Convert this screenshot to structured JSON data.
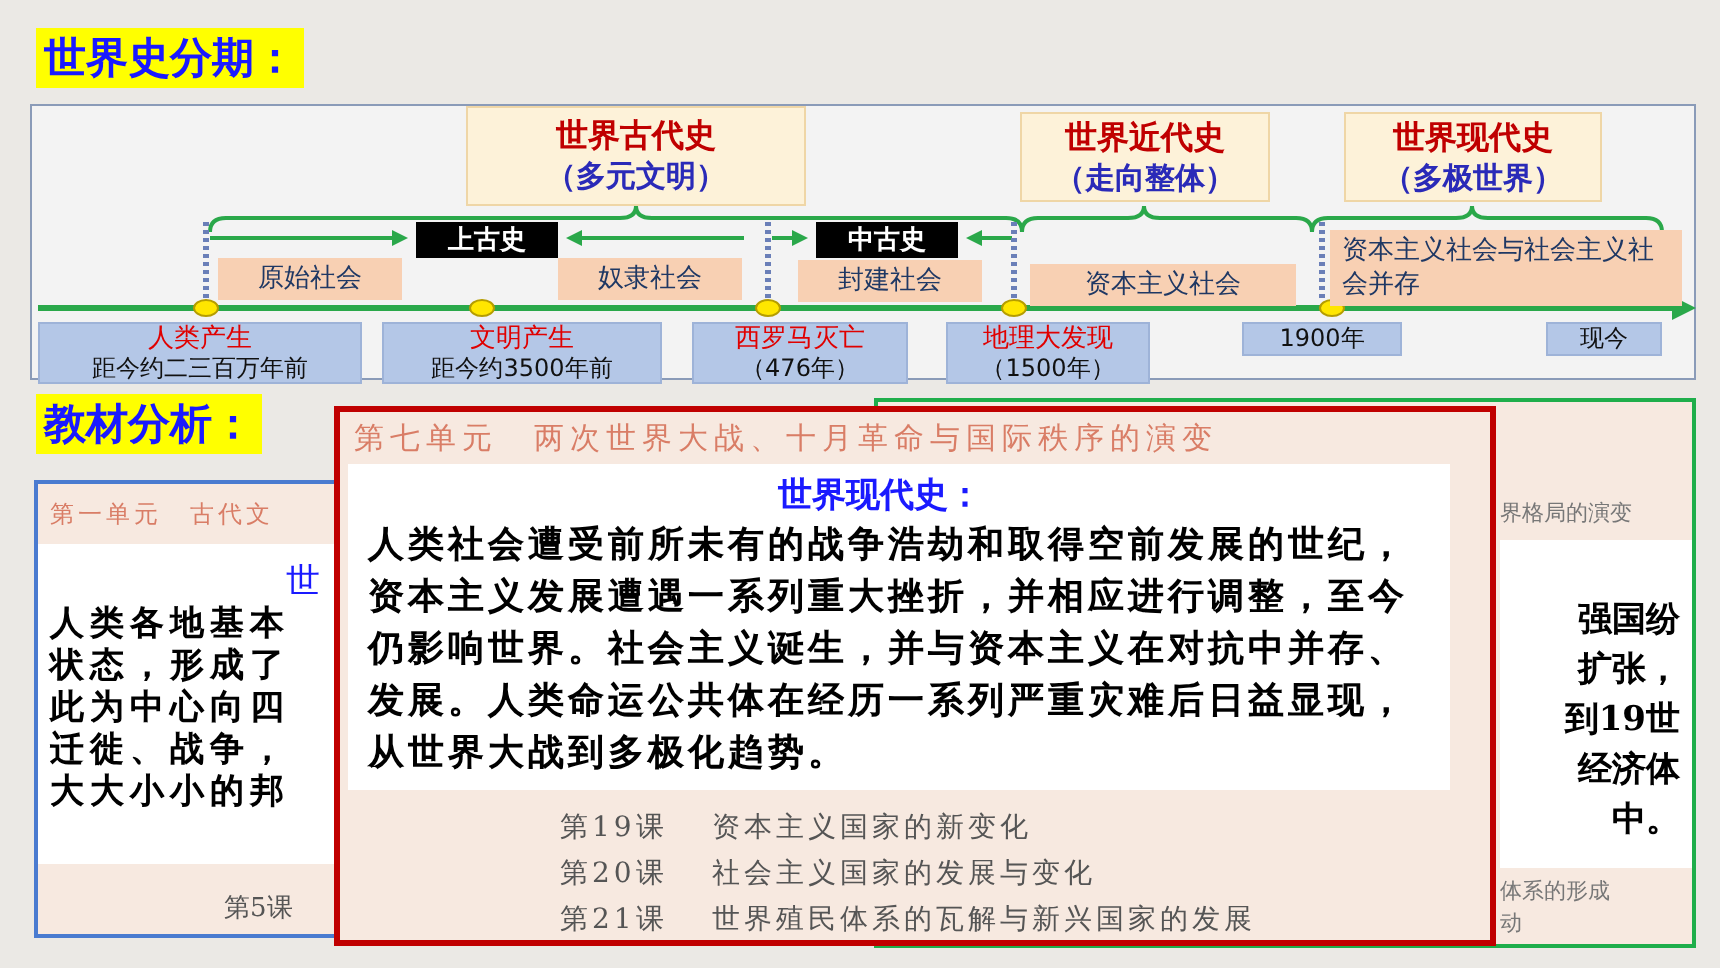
{
  "title": "世界史分期：",
  "timeline": {
    "eras": [
      {
        "name": "世界古代史",
        "subtitle": "（多元文明）"
      },
      {
        "name": "世界近代史",
        "subtitle": "（走向整体）"
      },
      {
        "name": "世界现代史",
        "subtitle": "（多极世界）"
      }
    ],
    "periods": [
      "上古史",
      "中古史"
    ],
    "societies": [
      "原始社会",
      "奴隶社会",
      "封建社会",
      "资本主义社会",
      "资本主义社会与社会主义社会并存"
    ],
    "milestones": [
      {
        "event": "人类产生",
        "time": "距今约二三百万年前"
      },
      {
        "event": "文明产生",
        "time": "距今约3500年前"
      },
      {
        "event": "西罗马灭亡",
        "time": "（476年）"
      },
      {
        "event": "地理大发现",
        "time": "（1500年）"
      },
      {
        "time": "1900年"
      },
      {
        "time": "现今"
      }
    ]
  },
  "section": "教材分析：",
  "left_card": {
    "unit": "第一单元　古代文",
    "heading": "世",
    "lines": [
      "人类各地基本",
      "状态，形成了",
      "此为中心向四",
      "迁徙、战争，",
      "大大小小的邦"
    ],
    "lesson": "第5课"
  },
  "right_card": {
    "unit": "界格局的演变",
    "lines": [
      "强国纷",
      "扩张，",
      "到19世",
      "经济体",
      "中。"
    ],
    "lessons": [
      "体系的形成",
      "动"
    ]
  },
  "front_card": {
    "unit": "第七单元　两次世界大战、十月革命与国际秩序的演变",
    "heading": "世界现代史：",
    "text": "人类社会遭受前所未有的战争浩劫和取得空前发展的世纪，资本主义发展遭遇一系列重大挫折，并相应进行调整，至今仍影响世界。社会主义诞生，并与资本主义在对抗中并存、发展。人类命运公共体在经历一系列严重灾难后日益显现，从世界大战到多极化趋势。",
    "lessons": [
      {
        "number": "第19课",
        "title": "资本主义国家的新变化"
      },
      {
        "number": "第20课",
        "title": "社会主义国家的发展与变化"
      },
      {
        "number": "第21课",
        "title": "世界殖民体系的瓦解与新兴国家的发展"
      }
    ]
  }
}
